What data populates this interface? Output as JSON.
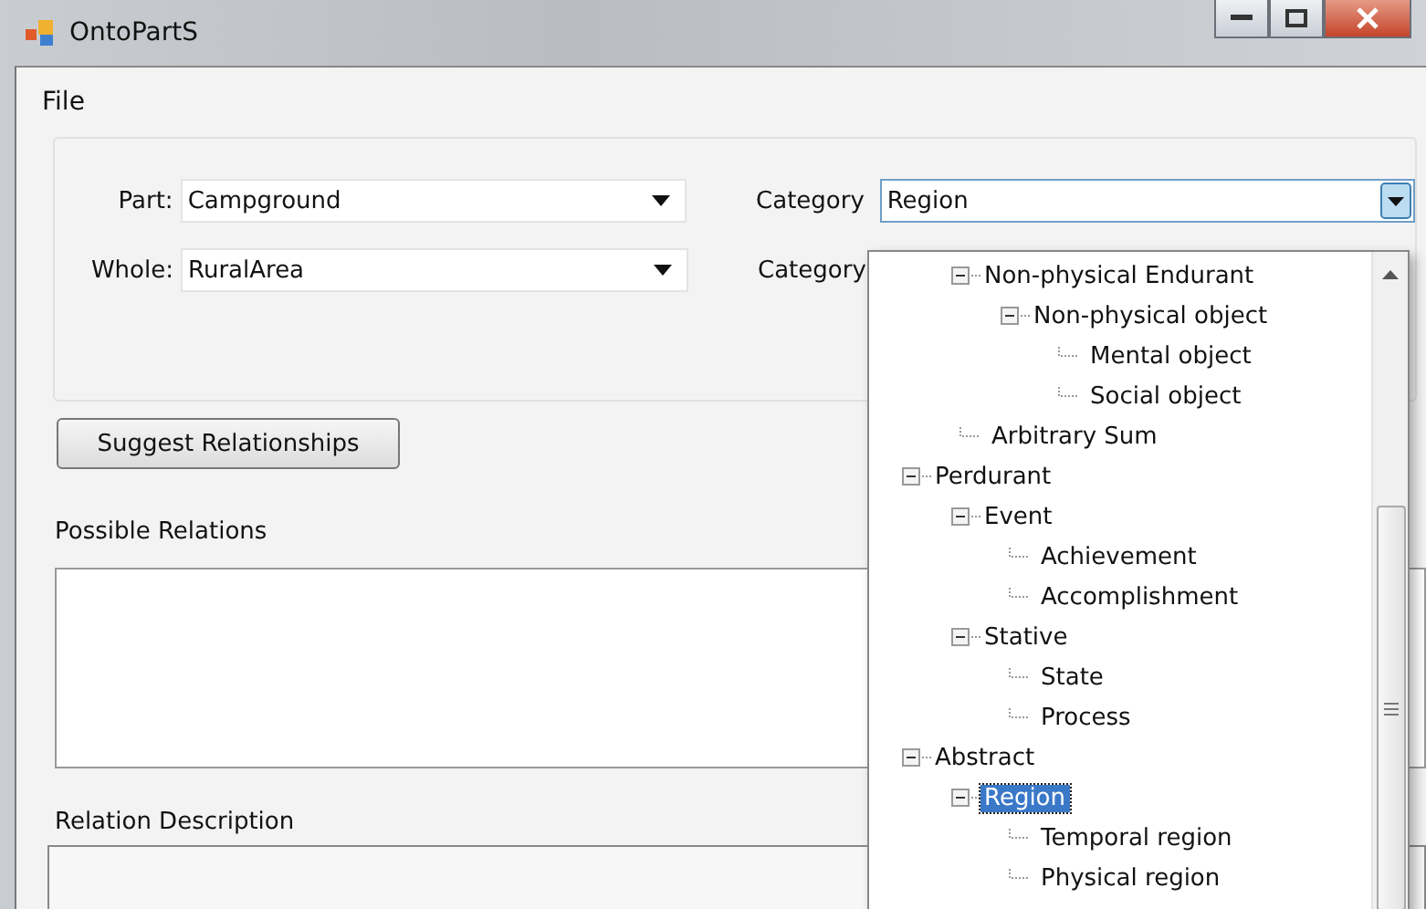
{
  "window": {
    "title": "OntoPartS"
  },
  "menu": [
    "File"
  ],
  "fields": [
    {
      "label": "Part:",
      "value": "Campground",
      "category_label": "Category",
      "category_value": "Region"
    },
    {
      "label": "Whole:",
      "value": "RuralArea",
      "category_label": "Category"
    }
  ],
  "suggest_button": "Suggest Relationships",
  "possible_relations": {
    "label": "Possible Relations"
  },
  "relation_description": {
    "label": "Relation Description"
  },
  "category_tree": [
    {
      "children": [
        {
          "label": "Non-physical Endurant",
          "expanded": true,
          "selected": false,
          "children": [
            {
              "label": "Non-physical object",
              "expanded": true,
              "selected": false,
              "children": [
                {
                  "label": "Mental object",
                  "selected": false
                },
                {
                  "label": "Social object",
                  "selected": false
                }
              ]
            }
          ]
        },
        {
          "label": "Arbitrary Sum",
          "selected": false
        }
      ]
    },
    {
      "label": "Perdurant",
      "expanded": true,
      "selected": false,
      "children": [
        {
          "label": "Event",
          "expanded": true,
          "selected": false,
          "children": [
            {
              "label": "Achievement",
              "selected": false
            },
            {
              "label": "Accomplishment",
              "selected": false
            }
          ]
        },
        {
          "label": "Stative",
          "expanded": true,
          "selected": false,
          "children": [
            {
              "label": "State",
              "selected": false
            },
            {
              "label": "Process",
              "selected": false
            }
          ]
        }
      ]
    },
    {
      "label": "Abstract",
      "expanded": true,
      "selected": false,
      "children": [
        {
          "label": "Region",
          "expanded": true,
          "selected": true,
          "children": [
            {
              "label": "Temporal region",
              "selected": false
            },
            {
              "label": "Physical region",
              "selected": false
            }
          ]
        }
      ]
    }
  ]
}
